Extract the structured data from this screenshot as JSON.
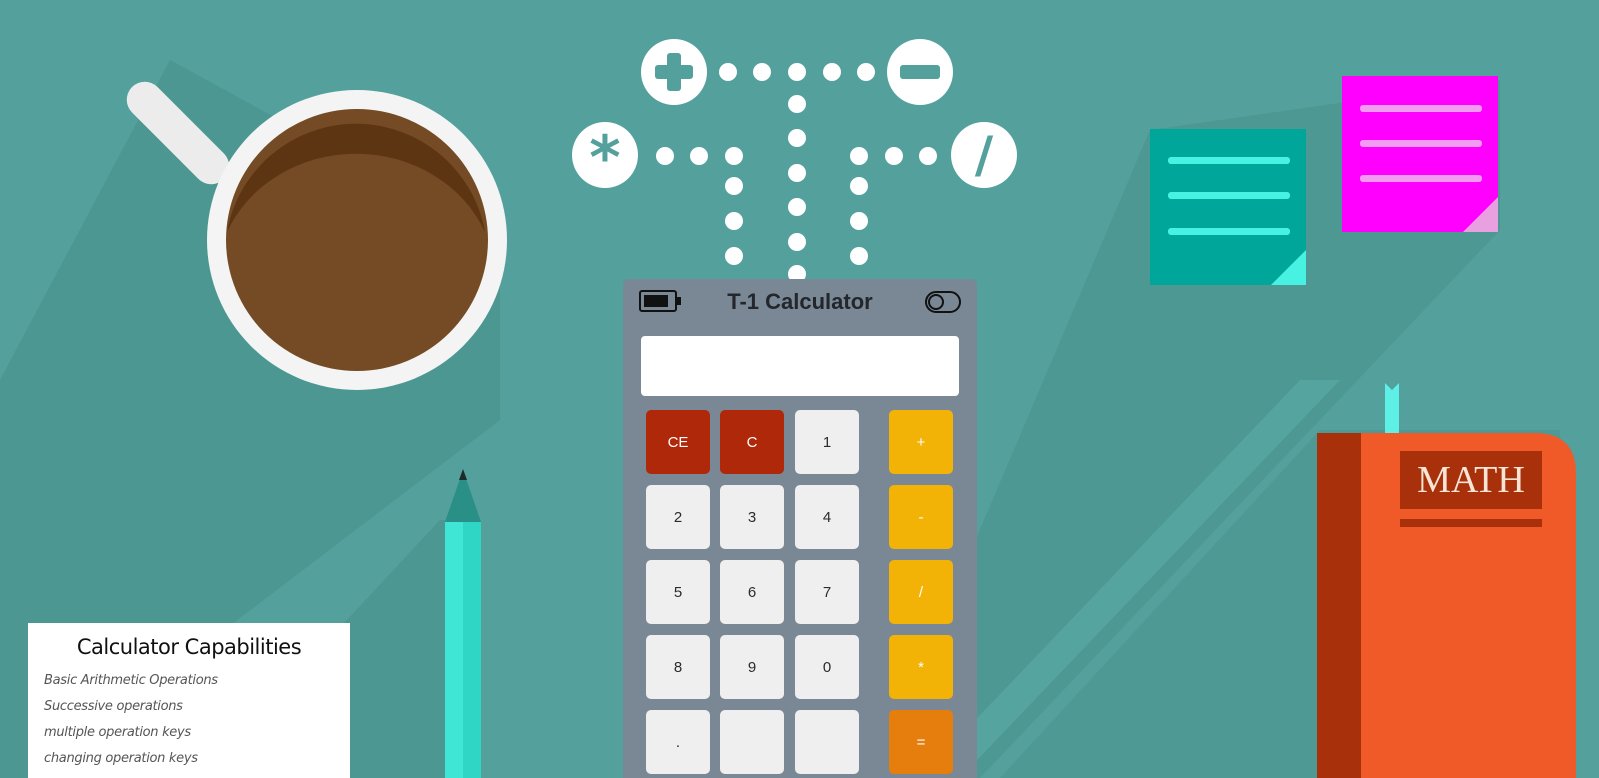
{
  "calculator": {
    "title": "T-1 Calculator",
    "display_value": "",
    "keys": {
      "ce": "CE",
      "c": "C",
      "one": "1",
      "plus": "+",
      "two": "2",
      "three": "3",
      "four": "4",
      "minus": "-",
      "five": "5",
      "six": "6",
      "seven": "7",
      "divide": "/",
      "eight": "8",
      "nine": "9",
      "zero": "0",
      "multiply": "*",
      "dot": ".",
      "blank1": "",
      "blank2": "",
      "equals": "="
    }
  },
  "capabilities": {
    "title": "Calculator Capabilities",
    "items": [
      "Basic Arithmetic Operations",
      "Successive operations",
      "multiple operation keys",
      "changing operation keys"
    ]
  },
  "book": {
    "label": "MATH"
  },
  "icons": {
    "battery": "battery-icon",
    "toggle": "toggle-switch-icon",
    "plus": "plus-circle-icon",
    "minus": "minus-circle-icon",
    "multiply": "asterisk-circle-icon",
    "divide": "slash-circle-icon"
  },
  "colors": {
    "background": "#53a09c",
    "calculator_body": "#7a8896",
    "key_clear": "#b0280a",
    "key_operator": "#f2b206",
    "key_equals": "#e57e0c",
    "note_teal": "#00a69a",
    "note_magenta": "#ff00ff",
    "book": "#f05a28"
  }
}
